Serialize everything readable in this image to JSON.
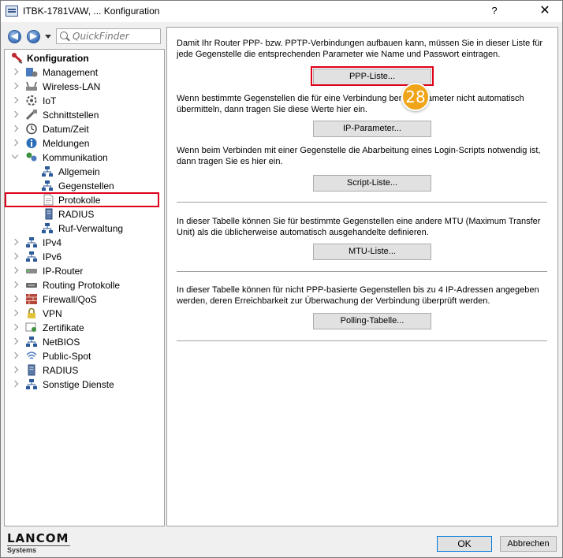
{
  "window": {
    "title": "ITBK-1781VAW, ... Konfiguration",
    "help": "?",
    "close": "✕"
  },
  "toolbar": {
    "back": "◀",
    "forward": "▶",
    "quickfinder_placeholder": "QuickFinder"
  },
  "tree": {
    "root": "Konfiguration",
    "items": [
      {
        "label": "Management",
        "icon": "management-icon"
      },
      {
        "label": "Wireless-LAN",
        "icon": "wlan-icon"
      },
      {
        "label": "IoT",
        "icon": "iot-icon"
      },
      {
        "label": "Schnittstellen",
        "icon": "interfaces-icon"
      },
      {
        "label": "Datum/Zeit",
        "icon": "clock-icon"
      },
      {
        "label": "Meldungen",
        "icon": "info-icon"
      },
      {
        "label": "Kommunikation",
        "icon": "communication-icon"
      },
      {
        "label": "Allgemein",
        "icon": "network-icon"
      },
      {
        "label": "Gegenstellen",
        "icon": "network-icon"
      },
      {
        "label": "Protokolle",
        "icon": "document-icon"
      },
      {
        "label": "RADIUS",
        "icon": "server-icon"
      },
      {
        "label": "Ruf-Verwaltung",
        "icon": "call-icon"
      },
      {
        "label": "IPv4",
        "icon": "network-icon"
      },
      {
        "label": "IPv6",
        "icon": "network-icon"
      },
      {
        "label": "IP-Router",
        "icon": "router-icon"
      },
      {
        "label": "Routing Protokolle",
        "icon": "routing-icon"
      },
      {
        "label": "Firewall/QoS",
        "icon": "firewall-icon"
      },
      {
        "label": "VPN",
        "icon": "lock-icon"
      },
      {
        "label": "Zertifikate",
        "icon": "certificate-icon"
      },
      {
        "label": "NetBIOS",
        "icon": "network-icon"
      },
      {
        "label": "Public-Spot",
        "icon": "wifi-icon"
      },
      {
        "label": "RADIUS",
        "icon": "server-icon"
      },
      {
        "label": "Sonstige Dienste",
        "icon": "network-icon"
      }
    ]
  },
  "content": {
    "sections": [
      {
        "text": "Damit Ihr Router PPP- bzw. PPTP-Verbindungen aufbauen kann, müssen Sie in dieser Liste für jede Gegenstelle die entsprechenden Parameter wie Name und Passwort eintragen.",
        "button": "PPP-Liste..."
      },
      {
        "text": "Wenn bestimmte Gegenstellen die für eine Verbindung benö                -Parameter nicht automatisch übermitteln, dann tragen Sie diese Werte hier ein.",
        "button": "IP-Parameter..."
      },
      {
        "text": "Wenn beim Verbinden mit einer Gegenstelle die Abarbeitung eines Login-Scripts notwendig ist, dann tragen Sie es hier ein.",
        "button": "Script-Liste..."
      },
      {
        "text": "In dieser Tabelle können Sie für bestimmte Gegenstellen eine andere MTU (Maximum Transfer Unit) als die üblicherweise automatisch ausgehandelte definieren.",
        "button": "MTU-Liste..."
      },
      {
        "text": "In dieser Tabelle können für nicht PPP-basierte Gegenstellen bis zu 4 IP-Adressen angegeben werden, deren Erreichbarkeit zur Überwachung der Verbindung überprüft werden.",
        "button": "Polling-Tabelle..."
      }
    ],
    "step_badge": "28"
  },
  "footer": {
    "logo": "LANCOM",
    "logo_sub": "Systems",
    "ok": "OK",
    "cancel": "Abbrechen"
  },
  "colors": {
    "highlight": "#e0001a",
    "badge": "#f0a418",
    "accent": "#0078d7"
  }
}
